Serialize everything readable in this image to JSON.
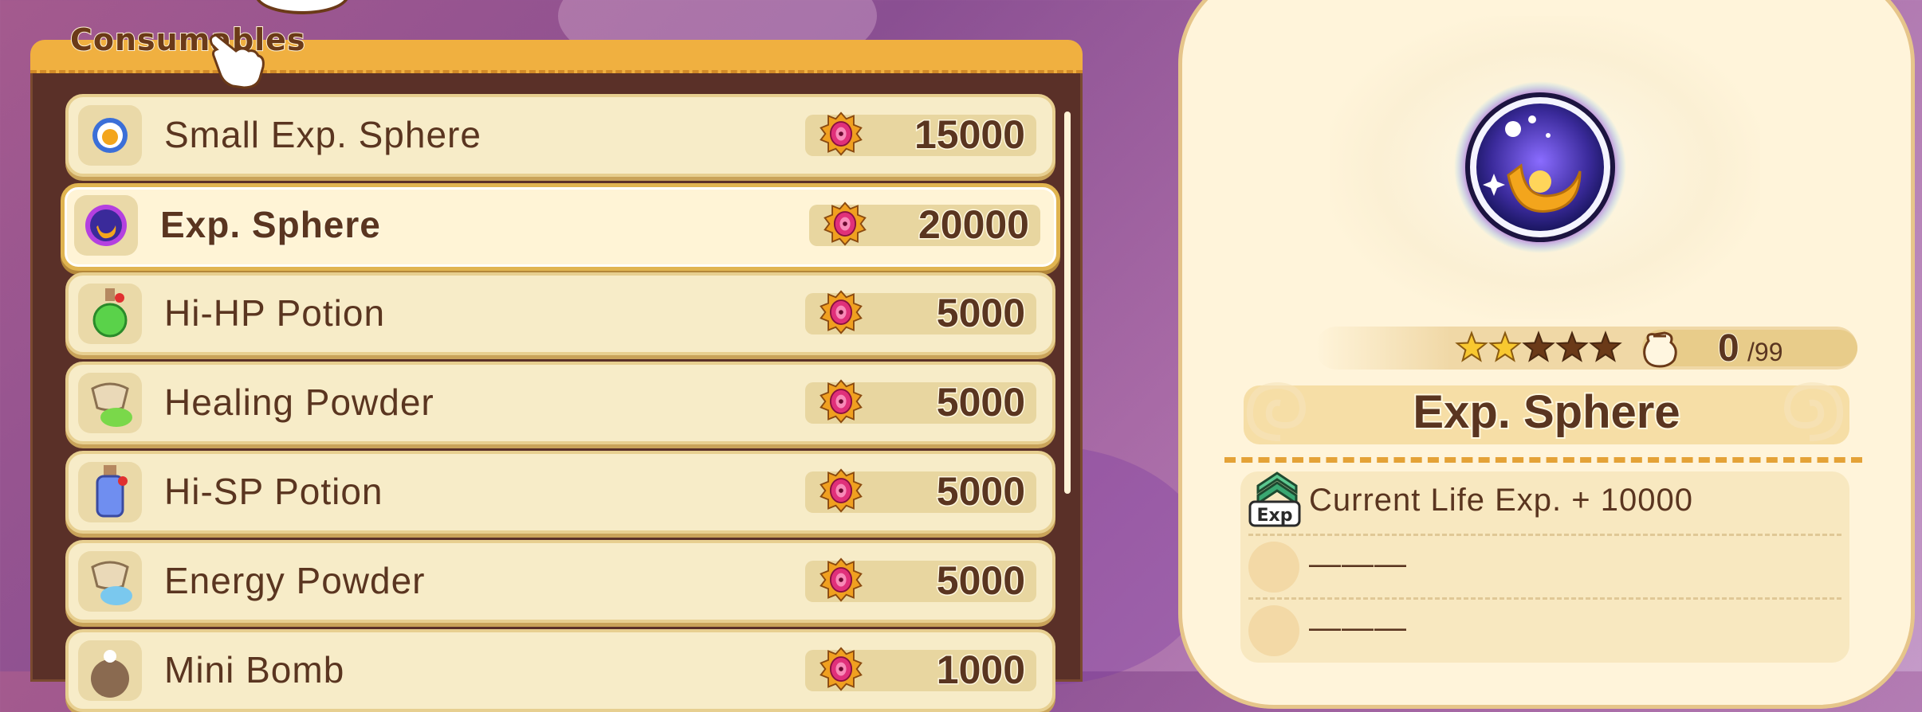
{
  "category": {
    "title": "Consumables"
  },
  "items": [
    {
      "name": "Small Exp. Sphere",
      "price": "15000",
      "icon": "small-exp-sphere-icon",
      "selected": false
    },
    {
      "name": "Exp. Sphere",
      "price": "20000",
      "icon": "exp-sphere-icon",
      "selected": true
    },
    {
      "name": "Hi-HP Potion",
      "price": "5000",
      "icon": "green-potion-icon",
      "selected": false
    },
    {
      "name": "Healing Powder",
      "price": "5000",
      "icon": "green-powder-bag-icon",
      "selected": false
    },
    {
      "name": "Hi-SP Potion",
      "price": "5000",
      "icon": "blue-potion-icon",
      "selected": false
    },
    {
      "name": "Energy Powder",
      "price": "5000",
      "icon": "blue-powder-bag-icon",
      "selected": false
    },
    {
      "name": "Mini Bomb",
      "price": "1000",
      "icon": "bomb-icon",
      "selected": false
    }
  ],
  "detail": {
    "item_name": "Exp. Sphere",
    "rarity_stars_filled": 2,
    "rarity_stars_total": 5,
    "owned": "0",
    "owned_max": "/99",
    "effects": [
      {
        "icon": "exp-up-icon",
        "text": "Current Life Exp. + 10000"
      },
      {
        "icon": "empty-slot",
        "text": "———"
      },
      {
        "icon": "empty-slot",
        "text": "———"
      }
    ]
  },
  "colors": {
    "panel_bg": "#fff4da",
    "row_bg": "#f7ecc8",
    "text_brown": "#5a3520",
    "accent_orange": "#f0b040",
    "currency_pink": "#e0307a"
  }
}
